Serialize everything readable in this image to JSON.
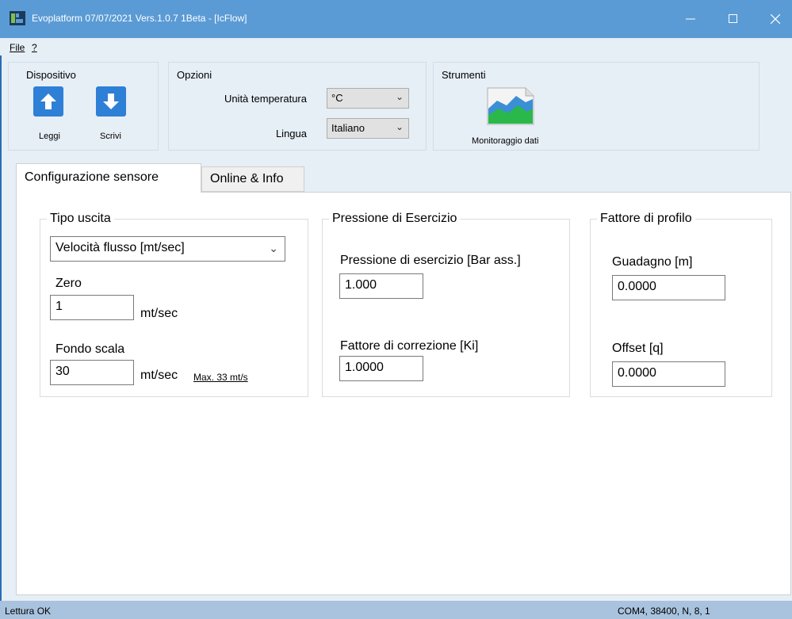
{
  "window": {
    "title": "Evoplatform 07/07/2021 Vers.1.0.7 1Beta - [IcFlow]",
    "accent": "#5b9bd5"
  },
  "menu": {
    "file": "File",
    "help": "?"
  },
  "dispositivo": {
    "title": "Dispositivo",
    "read_label": "Leggi",
    "write_label": "Scrivi"
  },
  "opzioni": {
    "title": "Opzioni",
    "temp_label": "Unità temperatura",
    "temp_value": "°C",
    "lang_label": "Lingua",
    "lang_value": "Italiano"
  },
  "strumenti": {
    "title": "Strumenti",
    "monitor_label": "Monitoraggio dati"
  },
  "tabs": [
    {
      "label": "Configurazione sensore",
      "active": true
    },
    {
      "label": "Online & Info",
      "active": false
    }
  ],
  "tipo_uscita": {
    "title": "Tipo uscita",
    "output_type": "Velocità flusso [mt/sec]",
    "zero_label": "Zero",
    "zero_value": "1",
    "zero_unit": "mt/sec",
    "fullscale_label": "Fondo scala",
    "fullscale_value": "30",
    "fullscale_unit": "mt/sec",
    "max_link": "Max. 33 mt/s"
  },
  "pressione": {
    "title": "Pressione di Esercizio",
    "pressure_label": "Pressione di esercizio [Bar ass.]",
    "pressure_value": "1.000",
    "correction_label": "Fattore di correzione [Ki]",
    "correction_value": "1.0000"
  },
  "profilo": {
    "title": "Fattore di profilo",
    "gain_label": "Guadagno [m]",
    "gain_value": "0.0000",
    "offset_label": "Offset [q]",
    "offset_value": "0.0000"
  },
  "status": {
    "left": "Lettura OK",
    "right": "COM4, 38400, N, 8, 1"
  }
}
